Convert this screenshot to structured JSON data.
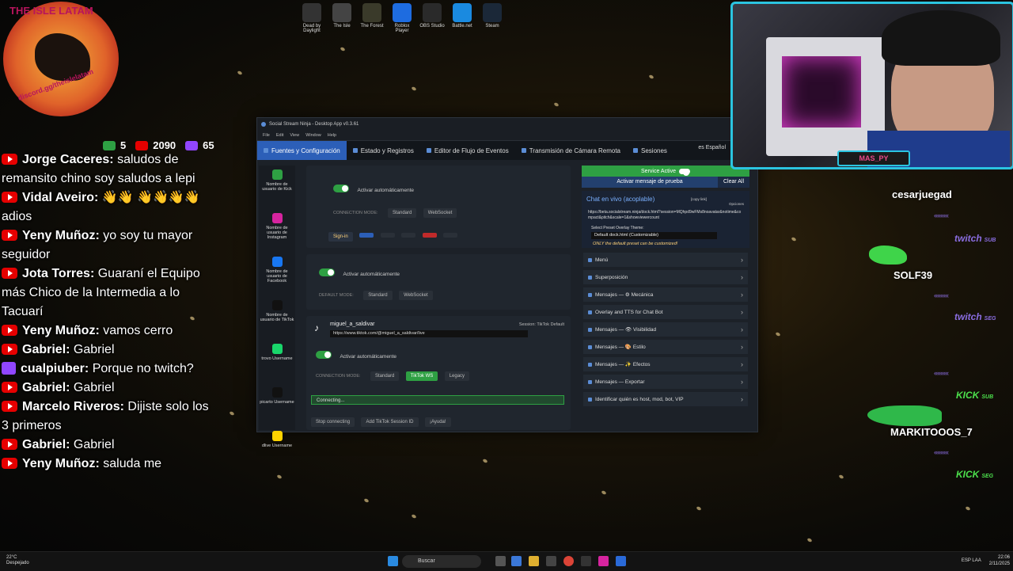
{
  "desktop_top_icons": [
    {
      "label": "Dead by Daylight",
      "icon": "dead-by-daylight-icon",
      "color": "#333333"
    },
    {
      "label": "The Isle",
      "icon": "the-isle-icon",
      "color": "#444444"
    },
    {
      "label": "The Forest",
      "icon": "the-forest-icon",
      "color": "#3a3a2a"
    },
    {
      "label": "Roblox Player",
      "icon": "roblox-icon",
      "color": "#1e6ce0"
    },
    {
      "label": "OBS Studio",
      "icon": "obs-icon",
      "color": "#2a2a2a"
    },
    {
      "label": "Battle.net",
      "icon": "battlenet-icon",
      "color": "#1a8ae0"
    },
    {
      "label": "Steam",
      "icon": "steam-icon",
      "color": "#1b2838"
    }
  ],
  "logo": {
    "ring_text": "THE ISLE LATAM",
    "bottom_text": "discord.gg/theislelatam"
  },
  "counters": {
    "kick": "5",
    "youtube": "2090",
    "twitch": "65"
  },
  "chat": [
    {
      "platform": "youtube",
      "name": "Jorge Caceres:",
      "text": "saludos de remansito chino soy saludos a lepi"
    },
    {
      "platform": "youtube",
      "name": "Vidal Aveiro:",
      "text": "👋👋 👋👋👋👋 adios"
    },
    {
      "platform": "youtube",
      "name": "Yeny Muñoz:",
      "text": "yo soy tu mayor seguidor"
    },
    {
      "platform": "youtube",
      "name": "Jota Torres:",
      "text": "Guaraní el Equipo más Chico de la Intermedia a lo Tacuarí"
    },
    {
      "platform": "youtube",
      "name": "Yeny Muñoz:",
      "text": "vamos cerro"
    },
    {
      "platform": "youtube",
      "name": "Gabriel:",
      "text": "Gabriel"
    },
    {
      "platform": "twitch",
      "name": "cualpiuber:",
      "text": "Porque no twitch?"
    },
    {
      "platform": "youtube",
      "name": "Gabriel:",
      "text": "Gabriel"
    },
    {
      "platform": "youtube",
      "name": "Marcelo Riveros:",
      "text": "Dijiste solo los 3 primeros"
    },
    {
      "platform": "youtube",
      "name": "Gabriel:",
      "text": "Gabriel"
    },
    {
      "platform": "youtube",
      "name": "Yeny Muñoz:",
      "text": "saluda me"
    }
  ],
  "app": {
    "title": "Social Stream Ninja - Desktop App v0.3.61",
    "menu": [
      "File",
      "Edit",
      "View",
      "Window",
      "Help"
    ],
    "tabs": [
      "Fuentes y Configuración",
      "Estado y Registros",
      "Editor de Flujo de Eventos",
      "Transmisión de Cámara Remota",
      "Sesiones"
    ],
    "language": "es Español",
    "sidebar": [
      {
        "label": "Nombre de usuario de Kick",
        "color": "#2ea043"
      },
      {
        "label": "Nombre de usuario de Instagram",
        "color": "#d6249f"
      },
      {
        "label": "Nombre de usuario de Facebook",
        "color": "#1877f2"
      },
      {
        "label": "Nombre de usuario de TikTok",
        "color": "#111111"
      },
      {
        "label": "trovo Username",
        "color": "#19d66b"
      },
      {
        "label": "picarto Username",
        "color": "#111111"
      },
      {
        "label": "dlive Username",
        "color": "#ffd300"
      }
    ],
    "center": {
      "auto_activate": "Activar automáticamente",
      "connection_mode": "CONNECTION MODE:",
      "default_mode": "DEFAULT MODE:",
      "standard": "Standard",
      "websocket": "WebSocket",
      "signin": "Sign-in",
      "tiktok_user": "miguel_a_saldivar",
      "session_label": "Session: TikTok Default",
      "tiktok_url": "https://www.tiktok.com/@miguel_a_saldivar/live",
      "tiktok_ws": "TikTok WS",
      "legacy": "Legacy",
      "connecting": "Connecting...",
      "stop": "Stop connecting",
      "add_session": "Add TikTok Session ID",
      "help": "¡Ayuda!"
    },
    "right": {
      "service": "Service Active",
      "test_msg": "Activar mensaje de prueba",
      "clear": "Clear All",
      "chat_live": "Chat en vivo (acoplable)",
      "copy_link": "[copy link]",
      "options": "Opciones",
      "url": "https://beta.socialstream.ninja/dock.html?session=MQhpd9wFMs8noavatar&notime&compact&pitch&scale=1&showviewercount",
      "preset_label": "Select Preset Overlay Theme:",
      "preset_value": "Default dock.html (Customizable)",
      "preset_note": "ONLY the default preset can be customized!",
      "accordions": [
        "Menú",
        "Superposición",
        "Mensajes — ⚙ Mecánica",
        "Overlay and TTS for Chat Bot",
        "Mensajes — 👁 Visibilidad",
        "Mensajes — 🎨 Estilo",
        "Mensajes — ✨ Efectos",
        "Mensajes — Exportar",
        "Identificar quién es host, mod, bot, VIP"
      ]
    }
  },
  "cam_label": "MAS_PY",
  "alerts": [
    {
      "user": "cesarjuegad",
      "platform": "twitch",
      "badge": "SUB"
    },
    {
      "user": "SOLF39",
      "platform": "twitch",
      "badge": "SEG"
    },
    {
      "user": "MARKITOOOS_7",
      "platform": "kick",
      "badge": "SUB"
    },
    {
      "user": "",
      "platform": "kick",
      "badge": "SEG"
    }
  ],
  "taskbar": {
    "weather_temp": "22°C",
    "weather_desc": "Despejado",
    "search": "Buscar",
    "lang": "ESP LAA",
    "time": "22:06",
    "date": "2/11/2025"
  }
}
